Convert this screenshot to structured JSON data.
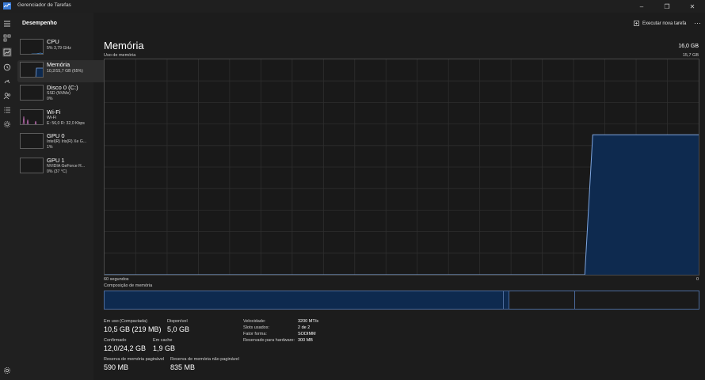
{
  "app": {
    "title": "Gerenciador de Tarefas"
  },
  "window": {
    "minimize": "–",
    "maximize": "❐",
    "close": "✕"
  },
  "sidebar": {
    "header": "Desempenho",
    "items": [
      {
        "name": "CPU",
        "sub1": "5% 3,79 GHz",
        "sub2": ""
      },
      {
        "name": "Memória",
        "sub1": "10,2/15,7 GB (65%)",
        "sub2": ""
      },
      {
        "name": "Disco 0 (C:)",
        "sub1": "SSD (NVMe)",
        "sub2": "0%"
      },
      {
        "name": "Wi-Fi",
        "sub1": "Wi-Fi",
        "sub2": "E: 56,0 R: 32,0 Kbps"
      },
      {
        "name": "GPU 0",
        "sub1": "Intel(R) Iris(R) Xe G...",
        "sub2": "1%"
      },
      {
        "name": "GPU 1",
        "sub1": "NVIDIA GeForce R...",
        "sub2": "0% (37 °C)"
      }
    ]
  },
  "header": {
    "run_task": "Executar nova tarefa",
    "more": "···"
  },
  "main": {
    "title": "Memória",
    "total": "16,0 GB",
    "usage_label": "Uso de memória",
    "usage_max": "15,7 GB",
    "x_left": "60 segundos",
    "x_right": "0",
    "composition_label": "Composição de memória"
  },
  "graph": {
    "max_gb": 15.7,
    "seconds": 60,
    "series": [
      {
        "t": 60,
        "gb": 0
      },
      {
        "t": 11.5,
        "gb": 0
      },
      {
        "t": 10.7,
        "gb": 10.2
      },
      {
        "t": 0,
        "gb": 10.2
      }
    ],
    "colors": {
      "line": "#7ea6e0",
      "fill": "#0e2a4f",
      "grid": "#2e2e2e"
    }
  },
  "composition": {
    "in_use_fraction": 0.67,
    "modified_fraction": 0.01,
    "standby_fraction": 0.11,
    "free_fraction": 0.21,
    "colors": {
      "in_use": "#0e2a4f",
      "border": "#4b6a9b"
    }
  },
  "stats": {
    "in_use_label": "Em uso (Compactada)",
    "in_use_value": "10,5 GB (219 MB)",
    "available_label": "Disponível",
    "available_value": "5,0 GB",
    "committed_label": "Confirmado",
    "committed_value": "12,0/24,2 GB",
    "cached_label": "Em cache",
    "cached_value": "1,9 GB",
    "paged_pool_label": "Reserva de memória paginável",
    "paged_pool_value": "590 MB",
    "nonpaged_pool_label": "Reserva de memória não paginável",
    "nonpaged_pool_value": "835 MB"
  },
  "info": {
    "speed_label": "Velocidade:",
    "speed_value": "3200 MT/s",
    "slots_label": "Slots usados:",
    "slots_value": "2 de 2",
    "form_label": "Fator forma:",
    "form_value": "SODIMM",
    "reserved_label": "Reservado para hardware:",
    "reserved_value": "300 MB"
  }
}
